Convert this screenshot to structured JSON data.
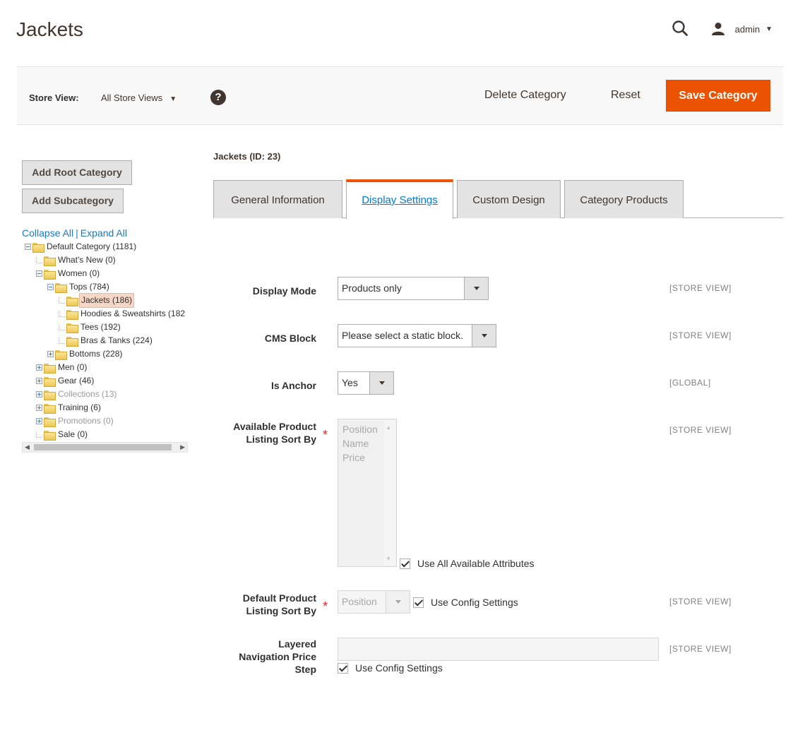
{
  "header": {
    "page_title": "Jackets",
    "admin_user": "admin"
  },
  "actions": {
    "store_view_label": "Store View:",
    "store_view_value": "All Store Views",
    "help_glyph": "?",
    "delete_label": "Delete Category",
    "reset_label": "Reset",
    "save_label": "Save Category"
  },
  "sidebar": {
    "add_root_label": "Add Root Category",
    "add_sub_label": "Add Subcategory",
    "collapse_all": "Collapse All",
    "separator": "|",
    "expand_all": "Expand All",
    "tree": [
      {
        "label": "Default Category (1181)",
        "toggle": "minus",
        "selected": false,
        "disabled": false
      },
      {
        "label": "What's New (0)",
        "toggle": "none",
        "selected": false,
        "disabled": false
      },
      {
        "label": "Women (0)",
        "toggle": "minus",
        "selected": false,
        "disabled": false
      },
      {
        "label": "Tops (784)",
        "toggle": "minus",
        "selected": false,
        "disabled": false
      },
      {
        "label": "Jackets (186)",
        "toggle": "none",
        "selected": true,
        "disabled": false
      },
      {
        "label": "Hoodies & Sweatshirts (182",
        "toggle": "none",
        "selected": false,
        "disabled": false
      },
      {
        "label": "Tees (192)",
        "toggle": "none",
        "selected": false,
        "disabled": false
      },
      {
        "label": "Bras & Tanks (224)",
        "toggle": "none",
        "selected": false,
        "disabled": false
      },
      {
        "label": "Bottoms (228)",
        "toggle": "plus",
        "selected": false,
        "disabled": false
      },
      {
        "label": "Men (0)",
        "toggle": "plus",
        "selected": false,
        "disabled": false
      },
      {
        "label": "Gear (46)",
        "toggle": "plus",
        "selected": false,
        "disabled": false
      },
      {
        "label": "Collections (13)",
        "toggle": "plus",
        "selected": false,
        "disabled": true
      },
      {
        "label": "Training (6)",
        "toggle": "plus",
        "selected": false,
        "disabled": false
      },
      {
        "label": "Promotions (0)",
        "toggle": "plus",
        "selected": false,
        "disabled": true
      },
      {
        "label": "Sale (0)",
        "toggle": "none",
        "selected": false,
        "disabled": false
      }
    ]
  },
  "main": {
    "entity_title": "Jackets (ID: 23)",
    "tabs": [
      {
        "label": "General Information",
        "active": false
      },
      {
        "label": "Display Settings",
        "active": true
      },
      {
        "label": "Custom Design",
        "active": false
      },
      {
        "label": "Category Products",
        "active": false
      }
    ],
    "fields": {
      "display_mode": {
        "label": "Display Mode",
        "value": "Products only",
        "scope": "[STORE VIEW]"
      },
      "cms_block": {
        "label": "CMS Block",
        "value": "Please select a static block.",
        "scope": "[STORE VIEW]"
      },
      "is_anchor": {
        "label": "Is Anchor",
        "value": "Yes",
        "scope": "[GLOBAL]"
      },
      "available_sort": {
        "label_line1": "Available Product",
        "label_line2": "Listing Sort By",
        "required_mark": "*",
        "options": [
          "Position",
          "Name",
          "Price"
        ],
        "checkbox_label": "Use All Available Attributes",
        "checked": true,
        "scope": "[STORE VIEW]"
      },
      "default_sort": {
        "label_line1": "Default Product",
        "label_line2": "Listing Sort By",
        "required_mark": "*",
        "value": "Position",
        "checkbox_label": "Use Config Settings",
        "checked": true,
        "scope": "[STORE VIEW]"
      },
      "price_step": {
        "label_line1": "Layered",
        "label_line2": "Navigation Price",
        "label_line3": "Step",
        "value": "",
        "checkbox_label": "Use Config Settings",
        "checked": true,
        "scope": "[STORE VIEW]"
      }
    }
  },
  "colors": {
    "accent": "#eb5202",
    "link": "#1979c3",
    "required": "#e22626"
  }
}
